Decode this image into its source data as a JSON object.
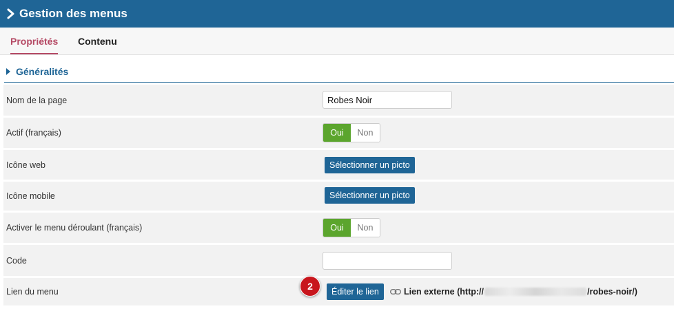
{
  "header": {
    "title": "Gestion des menus",
    "icon": "chevron-right-icon"
  },
  "tabs": [
    {
      "label": "Propriétés",
      "active": true
    },
    {
      "label": "Contenu",
      "active": false
    }
  ],
  "section": {
    "title": "Généralités",
    "icon": "caret-right-icon"
  },
  "fields": {
    "page_name": {
      "label": "Nom de la page",
      "value": "Robes Noir"
    },
    "actif": {
      "label": "Actif (français)",
      "on": "Oui",
      "off": "Non",
      "selected": "Oui"
    },
    "icon_web": {
      "label": "Icône web",
      "button": "Sélectionner un picto"
    },
    "icon_mobile": {
      "label": "Icône mobile",
      "button": "Sélectionner un picto"
    },
    "dropdown": {
      "label": "Activer le menu déroulant (français)",
      "on": "Oui",
      "off": "Non",
      "selected": "Oui"
    },
    "code": {
      "label": "Code",
      "value": ""
    },
    "menu_link": {
      "label": "Lien du menu",
      "button": "Éditer le lien",
      "link_prefix": "Lien externe (http://",
      "link_suffix": "/robes-noir/)",
      "link_icon": "link-icon"
    }
  },
  "callout_badge": "2",
  "colors": {
    "header": "#1f6596",
    "tab_active": "#b54a65",
    "toggle_on": "#5ba52d",
    "badge": "#c8161d",
    "button": "#1f6596"
  }
}
